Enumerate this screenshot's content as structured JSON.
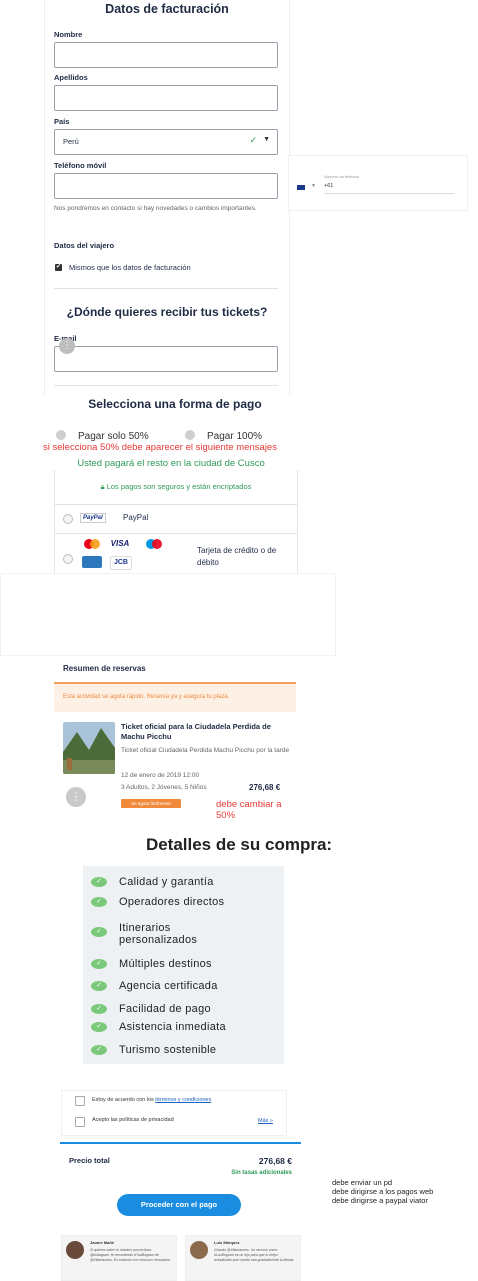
{
  "form": {
    "title": "Datos de facturación",
    "nombre_label": "Nombre",
    "apellidos_label": "Apellidos",
    "pais_label": "País",
    "pais_value": "Perú",
    "telefono_label": "Teléfono móvil",
    "telefono_hint": "Nos pondremos en contacto si hay novedades o cambios importantes.",
    "viajero_heading": "Datos del viajero",
    "mismos_label": "Mismos que los datos de facturación",
    "tickets_heading": "¿Dónde quieres recibir tus tickets?",
    "email_label": "E-mail"
  },
  "phone_panel": {
    "label": "Número de teléfono",
    "code": "+61"
  },
  "payment": {
    "title": "Selecciona una forma de pago",
    "option_50": "Pagar solo 50%",
    "option_100": "Pagar 100%",
    "red_note": "si selecciona 50% debe aparecer el siguiente mensajes",
    "green_note": "Usted pagará el resto en la ciudad de Cusco",
    "secure_text": "Los pagos son seguros y están encriptados",
    "paypal_badge": "PayPal",
    "paypal_label": "PayPal",
    "card_label": "Tarjeta de crédito o de débito",
    "card_visa": "VISA",
    "card_jcb": "JCB"
  },
  "summary": {
    "title": "Resumen de reservas",
    "urgency": "Esta actividad se agota rápido. Reserva ya y asegura tu plaza.",
    "ticket_title": "Ticket oficial para la Ciudadela Perdida de Machu Picchu",
    "ticket_subtitle": "Ticket oficial Ciudadela Perdida Machu Picchu por la tarde",
    "date": "12 de enero de 2019 12:00",
    "people": "3 Adultos, 2 Jóvenes, 5 Niños",
    "price": "276,68 €",
    "badge": "Se agota fácilmente",
    "red_note": "debe cambiar a 50%"
  },
  "details": {
    "title": "Detalles de su compra:",
    "features": [
      "Calidad y garantía",
      "Operadores directos",
      "Itinerarios personalizados",
      "Múltiples destinos",
      "Agencia certificada",
      "Facilidad de pago",
      "Asistencia inmediata",
      "Turismo sostenible"
    ]
  },
  "terms": {
    "accept_prefix": "Estoy de acuerdo con los ",
    "accept_link": "términos y condiciones",
    "privacy": "Acepto las políticas de privacidad",
    "more": "Más »"
  },
  "total": {
    "label": "Precio total",
    "amount": "276,68 €",
    "sub": "Sin tasas adicionales",
    "button": "Proceder con el pago"
  },
  "notes": [
    "debe enviar un pd",
    "debe dirigirse a los pagos web",
    "debe dirigirse a paypal viator"
  ],
  "reviews": [
    {
      "name": "Jaume Mañé",
      "text": "Si quieres saber lo máximo provechoso @instagram, te recomiendo #TuaBogram de @Vilamaunes. Es estación con recursos renovados."
    },
    {
      "name": "Luis Márquez",
      "text": "Gracias @Vilamaunes. Un recurso como #LuxBogram es un lujo para que lo mejor actualizado que cuento sea gradualmente la tienda."
    }
  ],
  "colors": {
    "accent": "#1b8de0",
    "success": "#2e9a57",
    "warning": "#f08a3a",
    "note": "#e53935"
  }
}
